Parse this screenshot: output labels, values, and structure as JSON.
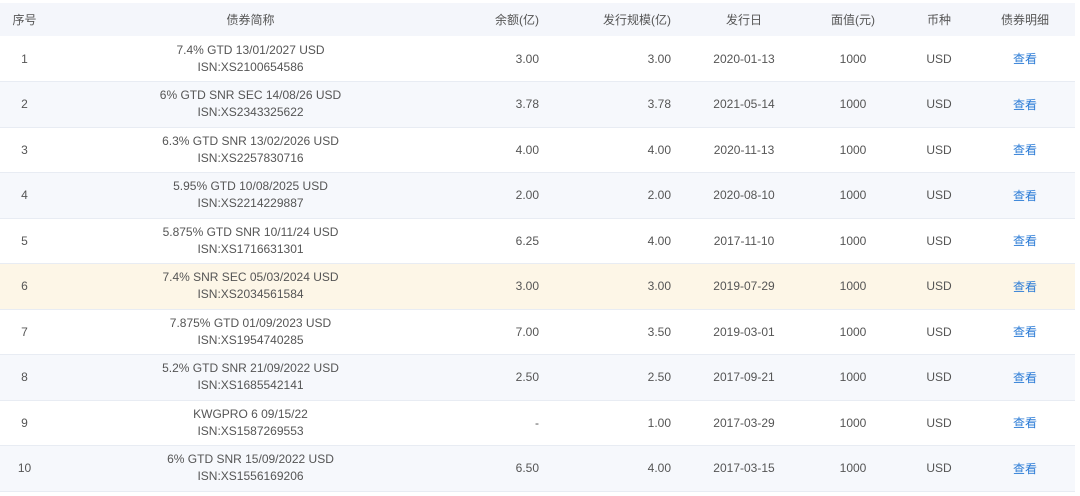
{
  "table": {
    "headers": [
      "序号",
      "债券简称",
      "余额(亿)",
      "发行规模(亿)",
      "发行日",
      "面值(元)",
      "币种",
      "债券明细"
    ],
    "rows": [
      {
        "index": "1",
        "name": "7.4% GTD 13/01/2027 USD",
        "isin": "ISN:XS2100654586",
        "balance": "3.00",
        "scale": "3.00",
        "issue_date": "2020-01-13",
        "face_value": "1000",
        "currency": "USD",
        "detail": "查看"
      },
      {
        "index": "2",
        "name": "6% GTD SNR SEC 14/08/26 USD",
        "isin": "ISN:XS2343325622",
        "balance": "3.78",
        "scale": "3.78",
        "issue_date": "2021-05-14",
        "face_value": "1000",
        "currency": "USD",
        "detail": "查看"
      },
      {
        "index": "3",
        "name": "6.3% GTD SNR 13/02/2026 USD",
        "isin": "ISN:XS2257830716",
        "balance": "4.00",
        "scale": "4.00",
        "issue_date": "2020-11-13",
        "face_value": "1000",
        "currency": "USD",
        "detail": "查看"
      },
      {
        "index": "4",
        "name": "5.95% GTD 10/08/2025 USD",
        "isin": "ISN:XS2214229887",
        "balance": "2.00",
        "scale": "2.00",
        "issue_date": "2020-08-10",
        "face_value": "1000",
        "currency": "USD",
        "detail": "查看"
      },
      {
        "index": "5",
        "name": "5.875% GTD SNR 10/11/24 USD",
        "isin": "ISN:XS1716631301",
        "balance": "6.25",
        "scale": "4.00",
        "issue_date": "2017-11-10",
        "face_value": "1000",
        "currency": "USD",
        "detail": "查看"
      },
      {
        "index": "6",
        "name": "7.4% SNR SEC 05/03/2024 USD",
        "isin": "ISN:XS2034561584",
        "balance": "3.00",
        "scale": "3.00",
        "issue_date": "2019-07-29",
        "face_value": "1000",
        "currency": "USD",
        "detail": "查看"
      },
      {
        "index": "7",
        "name": "7.875% GTD 01/09/2023 USD",
        "isin": "ISN:XS1954740285",
        "balance": "7.00",
        "scale": "3.50",
        "issue_date": "2019-03-01",
        "face_value": "1000",
        "currency": "USD",
        "detail": "查看"
      },
      {
        "index": "8",
        "name": "5.2% GTD SNR 21/09/2022 USD",
        "isin": "ISN:XS1685542141",
        "balance": "2.50",
        "scale": "2.50",
        "issue_date": "2017-09-21",
        "face_value": "1000",
        "currency": "USD",
        "detail": "查看"
      },
      {
        "index": "9",
        "name": "KWGPRO 6 09/15/22",
        "isin": "ISN:XS1587269553",
        "balance": "-",
        "scale": "1.00",
        "issue_date": "2017-03-29",
        "face_value": "1000",
        "currency": "USD",
        "detail": "查看"
      },
      {
        "index": "10",
        "name": "6% GTD SNR 15/09/2022 USD",
        "isin": "ISN:XS1556169206",
        "balance": "6.50",
        "scale": "4.00",
        "issue_date": "2017-03-15",
        "face_value": "1000",
        "currency": "USD",
        "detail": "查看"
      }
    ]
  },
  "colors": {
    "header_bg": "#f4f6fb",
    "row_alt_bg": "#f6f8fc",
    "row_highlight_bg": "#fdf6e7",
    "link": "#2b7bd6",
    "text": "#555555"
  }
}
